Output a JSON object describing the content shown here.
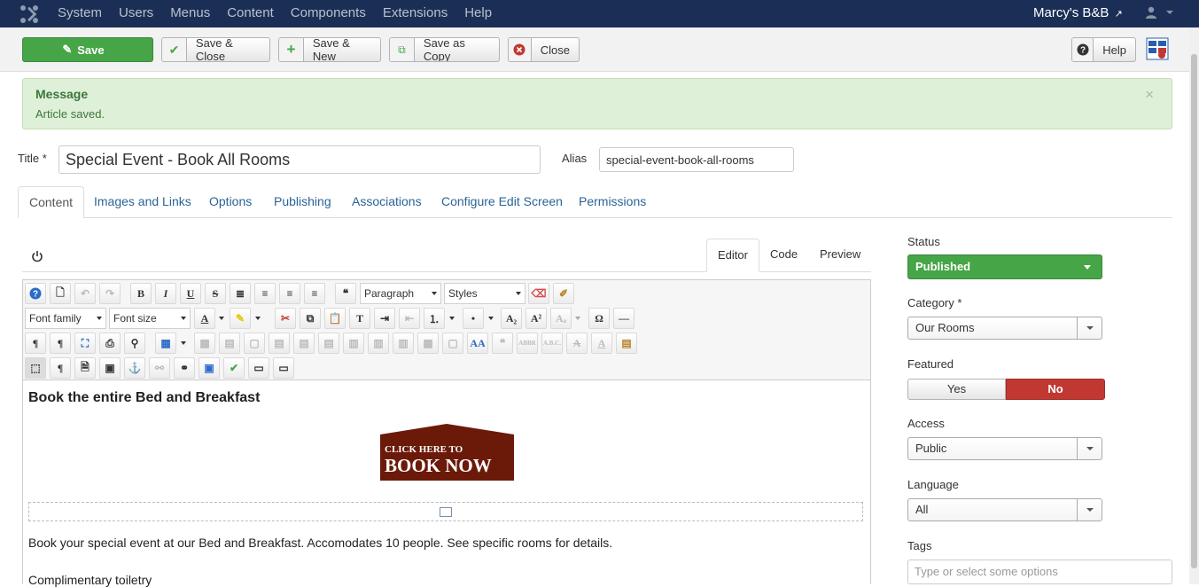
{
  "topnav": {
    "menu": [
      "System",
      "Users",
      "Menus",
      "Content",
      "Components",
      "Extensions",
      "Help"
    ],
    "site_name": "Marcy's B&B",
    "user_icon": "user-icon"
  },
  "toolbar": {
    "save_label": "Save",
    "save_close_label": "Save & Close",
    "save_new_label": "Save & New",
    "save_copy_label": "Save as Copy",
    "close_label": "Close",
    "help_label": "Help"
  },
  "alert": {
    "heading": "Message",
    "text": "Article saved.",
    "close": "×"
  },
  "form": {
    "title_label": "Title *",
    "title_value": "Special Event - Book All Rooms",
    "alias_label": "Alias",
    "alias_value": "special-event-book-all-rooms"
  },
  "tabs": [
    "Content",
    "Images and Links",
    "Options",
    "Publishing",
    "Associations",
    "Configure Edit Screen",
    "Permissions"
  ],
  "editor_tabs": [
    "Editor",
    "Code",
    "Preview"
  ],
  "editor_toolbar": {
    "format_select": "Paragraph",
    "styles_select": "Styles",
    "font_family": "Font family",
    "font_size": "Font size"
  },
  "content": {
    "heading": "Book the entire Bed and Breakfast",
    "banner_line1": "CLICK HERE TO",
    "banner_line2": "BOOK NOW",
    "paragraph": "Book your special event at our Bed and Breakfast. Accomodates 10 people. See specific rooms for details.",
    "paragraph2": "Complimentary toiletry"
  },
  "sidebar": {
    "status_label": "Status",
    "status_value": "Published",
    "category_label": "Category *",
    "category_value": "Our Rooms",
    "featured_label": "Featured",
    "featured_yes": "Yes",
    "featured_no": "No",
    "access_label": "Access",
    "access_value": "Public",
    "language_label": "Language",
    "language_value": "All",
    "tags_label": "Tags",
    "tags_placeholder": "Type or select some options"
  },
  "colors": {
    "topnav_bg": "#1b2f56",
    "success_green": "#46a546",
    "danger_red": "#c13833",
    "banner_brown": "#6b1a0a"
  }
}
